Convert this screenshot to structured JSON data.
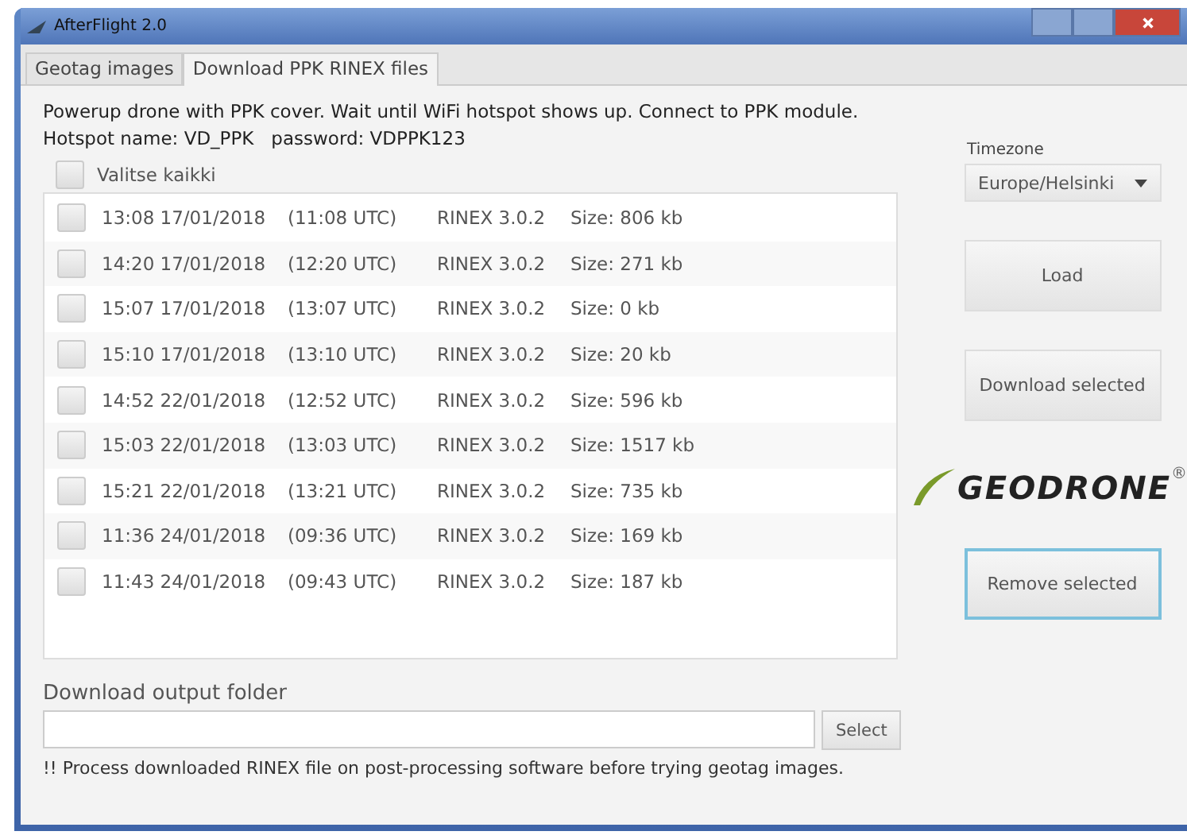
{
  "window": {
    "title": "AfterFlight 2.0"
  },
  "tabs": [
    {
      "label": "Geotag images",
      "selected": false
    },
    {
      "label": "Download PPK RINEX files",
      "selected": true
    }
  ],
  "instructions": [
    "Powerup drone with PPK cover. Wait until WiFi hotspot shows up. Connect to PPK module.",
    "Hotspot name: VD_PPK   password: VDPPK123"
  ],
  "select_all": {
    "label": "Valitse kaikki",
    "checked": false
  },
  "files": [
    {
      "local": "13:08 17/01/2018",
      "utc": "(11:08 UTC)",
      "format": "RINEX 3.0.2",
      "size": "Size: 806 kb",
      "checked": false
    },
    {
      "local": "14:20 17/01/2018",
      "utc": "(12:20 UTC)",
      "format": "RINEX 3.0.2",
      "size": "Size: 271 kb",
      "checked": false
    },
    {
      "local": "15:07 17/01/2018",
      "utc": "(13:07 UTC)",
      "format": "RINEX 3.0.2",
      "size": "Size: 0 kb",
      "checked": false
    },
    {
      "local": "15:10 17/01/2018",
      "utc": "(13:10 UTC)",
      "format": "RINEX 3.0.2",
      "size": "Size: 20 kb",
      "checked": false
    },
    {
      "local": "14:52 22/01/2018",
      "utc": "(12:52 UTC)",
      "format": "RINEX 3.0.2",
      "size": "Size: 596 kb",
      "checked": false
    },
    {
      "local": "15:03 22/01/2018",
      "utc": "(13:03 UTC)",
      "format": "RINEX 3.0.2",
      "size": "Size: 1517 kb",
      "checked": false
    },
    {
      "local": "15:21 22/01/2018",
      "utc": "(13:21 UTC)",
      "format": "RINEX 3.0.2",
      "size": "Size: 735 kb",
      "checked": false
    },
    {
      "local": "11:36 24/01/2018",
      "utc": "(09:36 UTC)",
      "format": "RINEX 3.0.2",
      "size": "Size: 169 kb",
      "checked": false
    },
    {
      "local": "11:43 24/01/2018",
      "utc": "(09:43 UTC)",
      "format": "RINEX 3.0.2",
      "size": "Size: 187 kb",
      "checked": false
    }
  ],
  "timezone": {
    "label": "Timezone",
    "value": "Europe/Helsinki"
  },
  "buttons": [
    {
      "label": "Load",
      "focused": false
    },
    {
      "label": "Download selected",
      "focused": false
    }
  ],
  "logo": {
    "text": "GEODRONE",
    "mark": "®"
  },
  "remove_button": {
    "label": "Remove selected",
    "focused": true
  },
  "output_folder": {
    "label": "Download output folder",
    "button": "Select"
  },
  "note": "!! Process downloaded RINEX file on post-processing software before trying geotag images."
}
